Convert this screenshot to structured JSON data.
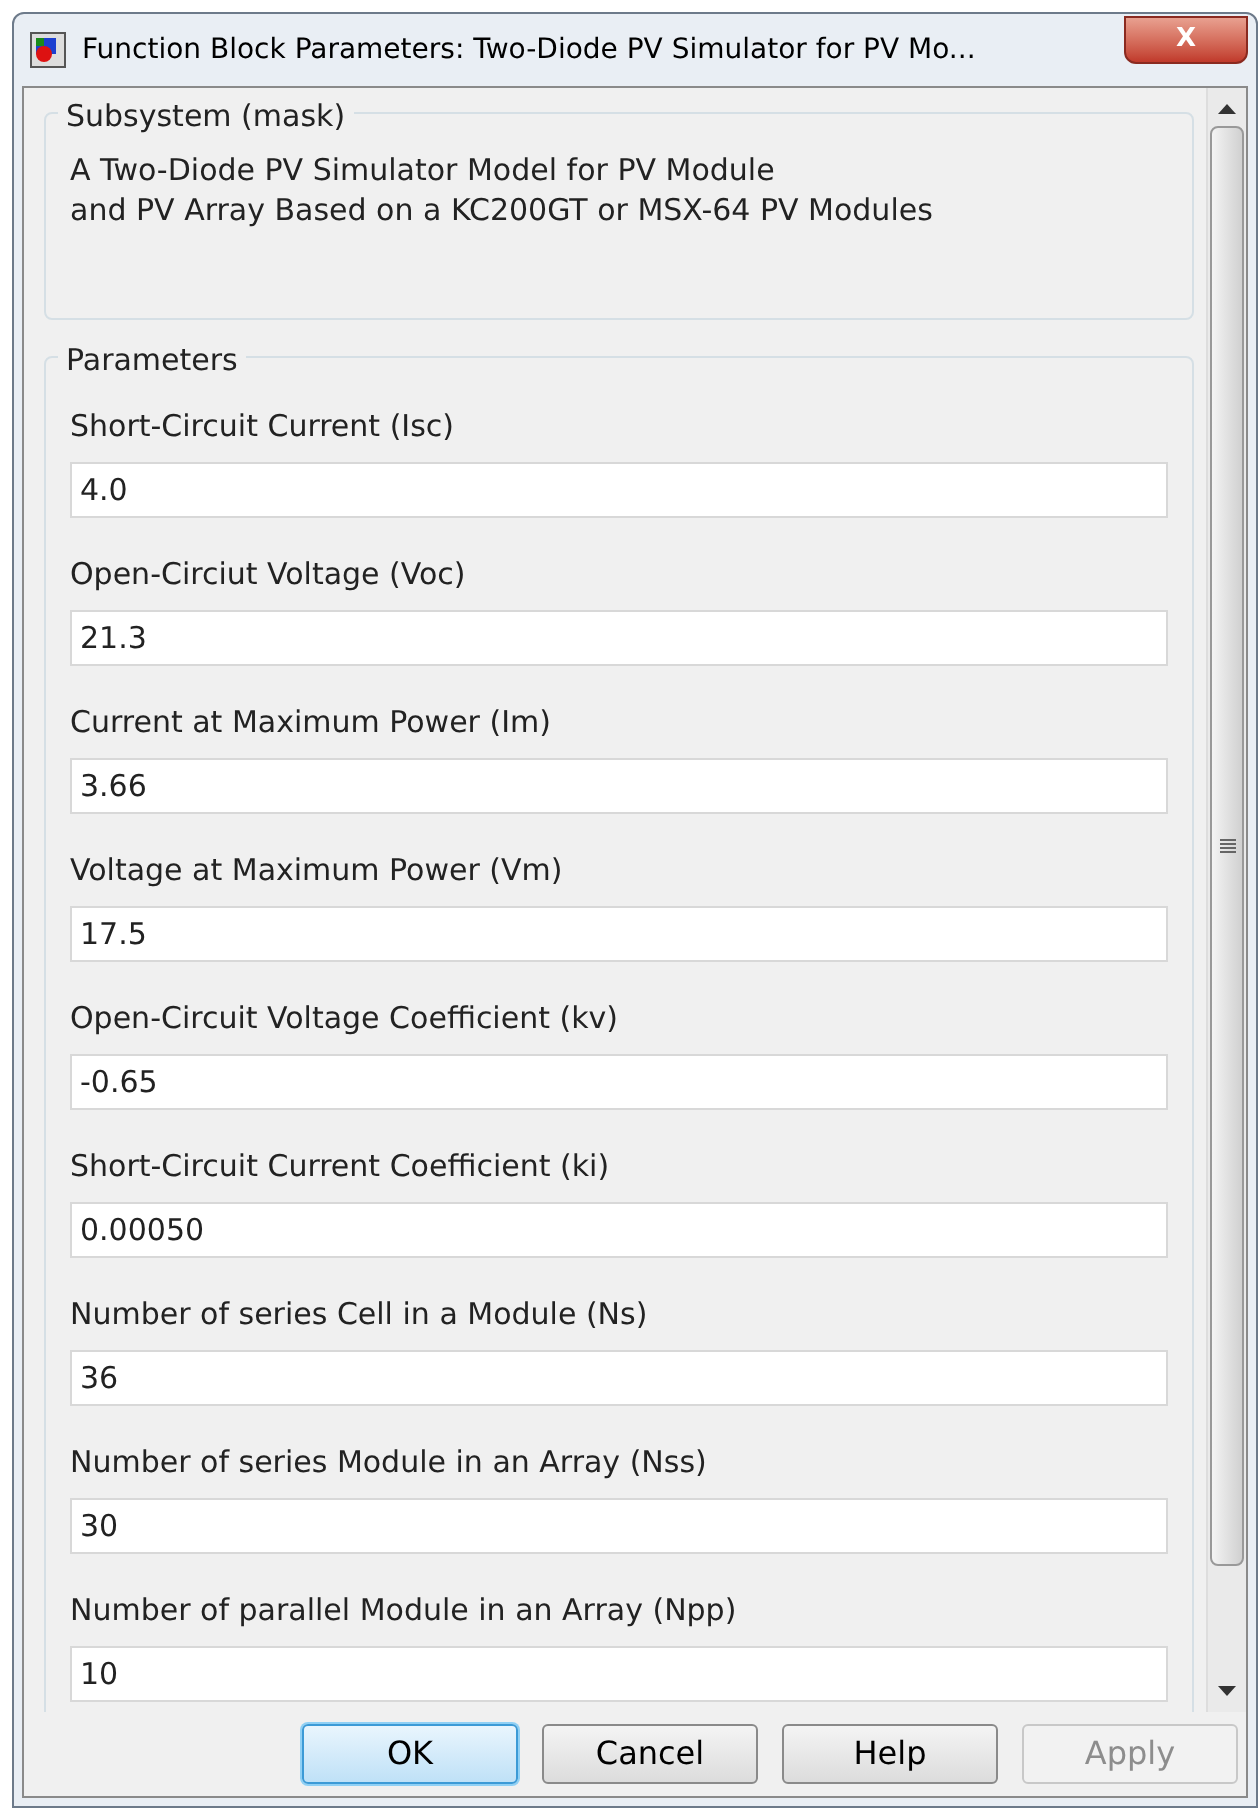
{
  "window": {
    "title": "Function Block Parameters: Two-Diode PV Simulator for PV Mo...",
    "close": "X"
  },
  "subsystem": {
    "title": "Subsystem (mask)",
    "description": "A Two-Diode PV Simulator Model for PV Module\nand PV Array Based on a KC200GT or MSX-64 PV Modules"
  },
  "parameters": {
    "title": "Parameters",
    "fields": [
      {
        "label": "Short-Circuit Current (Isc)",
        "value": "4.0"
      },
      {
        "label": "Open-Circiut Voltage (Voc)",
        "value": "21.3"
      },
      {
        "label": "Current at Maximum Power (Im)",
        "value": "3.66"
      },
      {
        "label": "Voltage at Maximum Power (Vm)",
        "value": "17.5"
      },
      {
        "label": "Open-Circuit Voltage Coefficient (kv)",
        "value": "-0.65"
      },
      {
        "label": "Short-Circuit Current Coefficient (ki)",
        "value": "0.00050"
      },
      {
        "label": "Number of series Cell in a Module (Ns)",
        "value": "36"
      },
      {
        "label": "Number of series Module in an Array (Nss)",
        "value": "30"
      },
      {
        "label": "Number of parallel Module in an Array (Npp)",
        "value": "10"
      }
    ]
  },
  "buttons": [
    {
      "label": "OK",
      "default": true,
      "disabled": false
    },
    {
      "label": "Cancel",
      "default": false,
      "disabled": false
    },
    {
      "label": "Help",
      "default": false,
      "disabled": false
    },
    {
      "label": "Apply",
      "default": false,
      "disabled": true
    }
  ]
}
